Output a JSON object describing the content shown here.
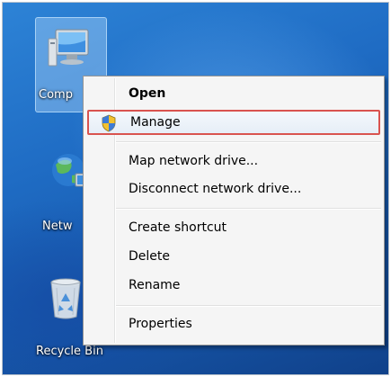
{
  "desktop": {
    "icons": [
      {
        "label": "Comp",
        "icon": "computer-icon"
      },
      {
        "label": "Netw",
        "icon": "network-icon"
      },
      {
        "label": "Recycle Bin",
        "icon": "recycle-bin-icon"
      }
    ]
  },
  "context_menu": {
    "items": [
      {
        "label": "Open",
        "bold": true
      },
      {
        "label": "Manage",
        "icon": "uac-shield-icon",
        "highlighted": true
      },
      {
        "label": "Map network drive..."
      },
      {
        "label": "Disconnect network drive..."
      },
      {
        "label": "Create shortcut"
      },
      {
        "label": "Delete"
      },
      {
        "label": "Rename"
      },
      {
        "label": "Properties"
      }
    ]
  },
  "colors": {
    "desktop_blue": "#1f6cc4",
    "menu_background": "#f5f5f5",
    "highlight_border": "#d9534f"
  }
}
